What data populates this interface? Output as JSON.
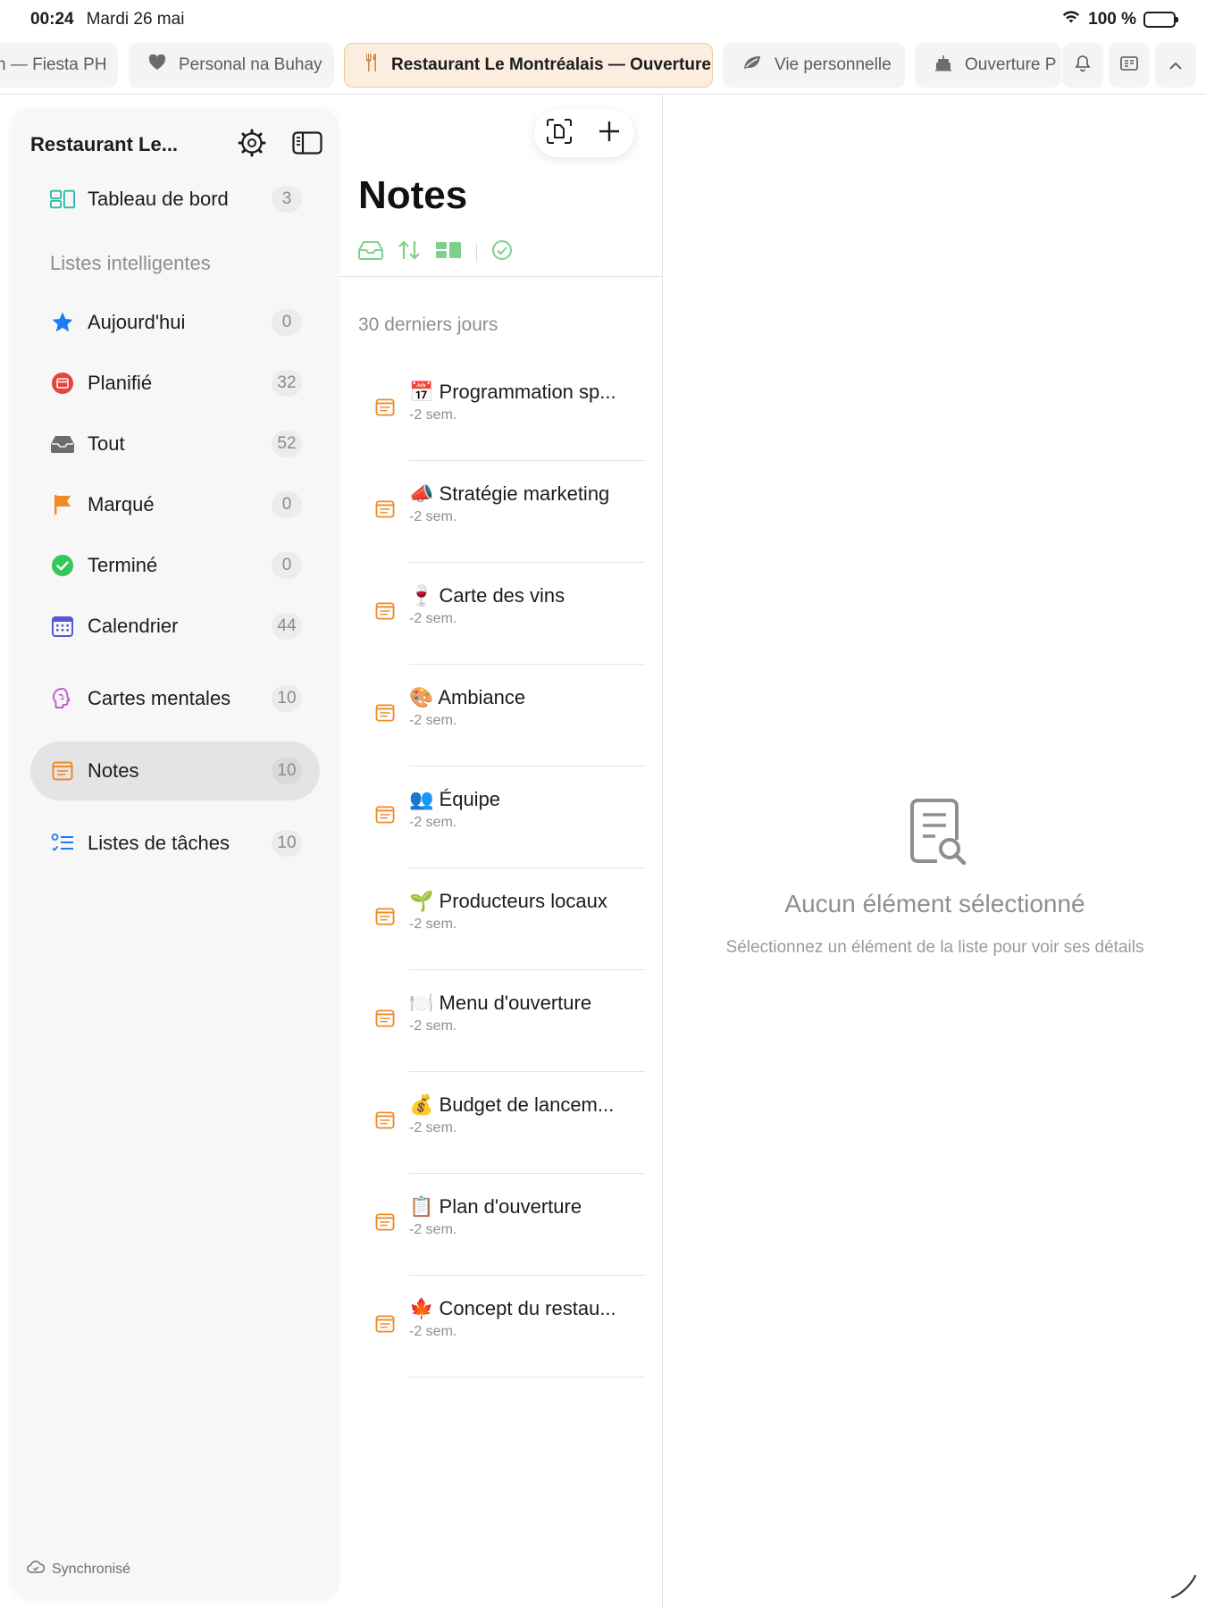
{
  "status": {
    "time": "00:24",
    "date": "Mardi 26 mai",
    "battery": "100 %"
  },
  "tabs": [
    {
      "label": "n — Fiesta PH",
      "icon": "none"
    },
    {
      "label": "Personal na Buhay",
      "icon": "heart-icon"
    },
    {
      "label": "Restaurant Le Montréalais — Ouverture",
      "icon": "fork-knife-icon",
      "active": true
    },
    {
      "label": "Vie personnelle",
      "icon": "leaf-icon"
    },
    {
      "label": "Ouverture P",
      "icon": "cake-icon"
    }
  ],
  "sidebar": {
    "title": "Restaurant Le...",
    "dashboard": {
      "label": "Tableau de bord",
      "count": "3"
    },
    "section_label": "Listes intelligentes",
    "items": [
      {
        "label": "Aujourd'hui",
        "count": "0",
        "icon": "star-icon",
        "color": "#1e7cf2"
      },
      {
        "label": "Planifié",
        "count": "32",
        "icon": "calendar-red-icon",
        "color": "#e5453a"
      },
      {
        "label": "Tout",
        "count": "52",
        "icon": "tray-icon",
        "color": "#6b6b70"
      },
      {
        "label": "Marqué",
        "count": "0",
        "icon": "flag-icon",
        "color": "#f08a24"
      },
      {
        "label": "Terminé",
        "count": "0",
        "icon": "checkmark-circle-icon",
        "color": "#34c759"
      },
      {
        "label": "Calendrier",
        "count": "44",
        "icon": "calendar-grid-icon",
        "color": "#5856d6"
      }
    ],
    "extra_items": [
      {
        "label": "Cartes mentales",
        "count": "10",
        "icon": "brain-icon",
        "color": "#c061cb"
      },
      {
        "label": "Notes",
        "count": "10",
        "icon": "note-icon",
        "color": "#f08a24",
        "selected": true
      },
      {
        "label": "Listes de tâches",
        "count": "10",
        "icon": "checklist-icon",
        "color": "#1e7cf2"
      }
    ],
    "footer": "Synchronisé"
  },
  "list": {
    "title": "Notes",
    "group": "30 derniers jours",
    "notes": [
      {
        "emoji": "📅",
        "title": "Programmation sp...",
        "meta": "-2 sem."
      },
      {
        "emoji": "📣",
        "title": "Stratégie marketing",
        "meta": "-2 sem."
      },
      {
        "emoji": "🍷",
        "title": "Carte des vins",
        "meta": "-2 sem."
      },
      {
        "emoji": "🎨",
        "title": "Ambiance",
        "meta": "-2 sem."
      },
      {
        "emoji": "👥",
        "title": "Équipe",
        "meta": "-2 sem."
      },
      {
        "emoji": "🌱",
        "title": "Producteurs locaux",
        "meta": "-2 sem."
      },
      {
        "emoji": "🍽️",
        "title": "Menu d'ouverture",
        "meta": "-2 sem."
      },
      {
        "emoji": "💰",
        "title": "Budget de lancem...",
        "meta": "-2 sem."
      },
      {
        "emoji": "📋",
        "title": "Plan d'ouverture",
        "meta": "-2 sem."
      },
      {
        "emoji": "🍁",
        "title": "Concept du restau...",
        "meta": "-2 sem."
      }
    ]
  },
  "detail": {
    "empty_title": "Aucun élément sélectionné",
    "empty_subtitle": "Sélectionnez un élément de la liste pour voir ses détails"
  },
  "colors": {
    "accent": "#f08a24",
    "filter_green": "#7fd08a"
  }
}
